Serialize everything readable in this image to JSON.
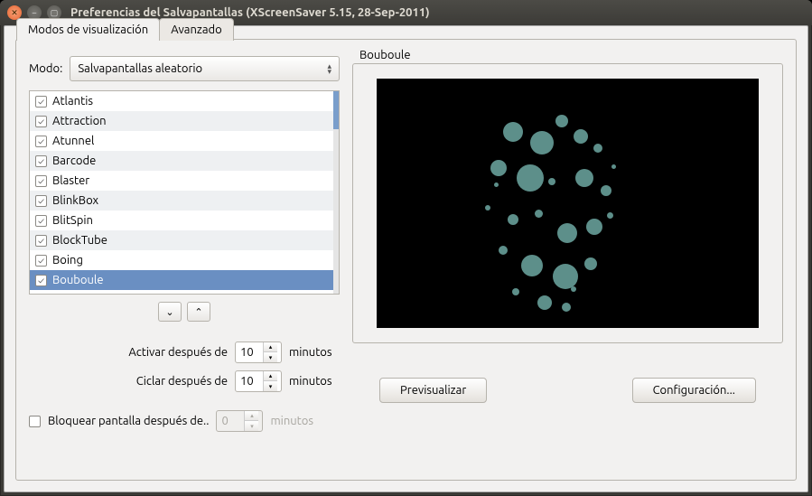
{
  "window": {
    "title": "Preferencias del Salvapantallas  (XScreenSaver 5.15, 28-Sep-2011)"
  },
  "tabs": {
    "display_modes": "Modos de visualización",
    "advanced": "Avanzado"
  },
  "mode": {
    "label": "Modo:",
    "value": "Salvapantallas aleatorio"
  },
  "savers": [
    {
      "name": "Atlantis",
      "checked": true
    },
    {
      "name": "Attraction",
      "checked": true
    },
    {
      "name": "Atunnel",
      "checked": true
    },
    {
      "name": "Barcode",
      "checked": true
    },
    {
      "name": "Blaster",
      "checked": true
    },
    {
      "name": "BlinkBox",
      "checked": true
    },
    {
      "name": "BlitSpin",
      "checked": true
    },
    {
      "name": "BlockTube",
      "checked": true
    },
    {
      "name": "Boing",
      "checked": true
    },
    {
      "name": "Bouboule",
      "checked": true,
      "selected": true
    }
  ],
  "timing": {
    "activate_label": "Activar después de",
    "activate_value": "10",
    "cycle_label": "Ciclar después de",
    "cycle_value": "10",
    "unit": "minutos",
    "lock_label": "Bloquear pantalla después de..",
    "lock_value": "0",
    "lock_checked": false
  },
  "preview": {
    "title": "Bouboule"
  },
  "buttons": {
    "preview": "Previsualizar",
    "settings": "Configuración..."
  }
}
